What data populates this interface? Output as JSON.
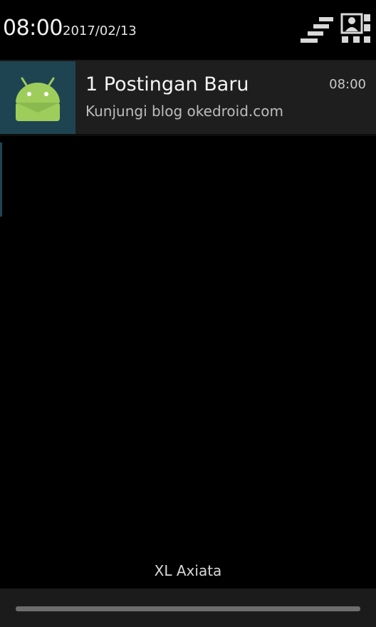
{
  "status_header": {
    "time": "08:00",
    "date": "2017/02/13",
    "settings_icon": "settings-icon",
    "profile_icon": "profile-icon"
  },
  "notification": {
    "icon": "android-robot-icon",
    "title": "1 Postingan Baru",
    "text": "Kunjungi blog okedroid.com",
    "time": "08:00"
  },
  "carrier": "XL Axiata",
  "colors": {
    "background": "#000000",
    "notification_background": "#1e1e1e",
    "icon_background": "#1f4451",
    "android_green": "#9ecd5c"
  }
}
